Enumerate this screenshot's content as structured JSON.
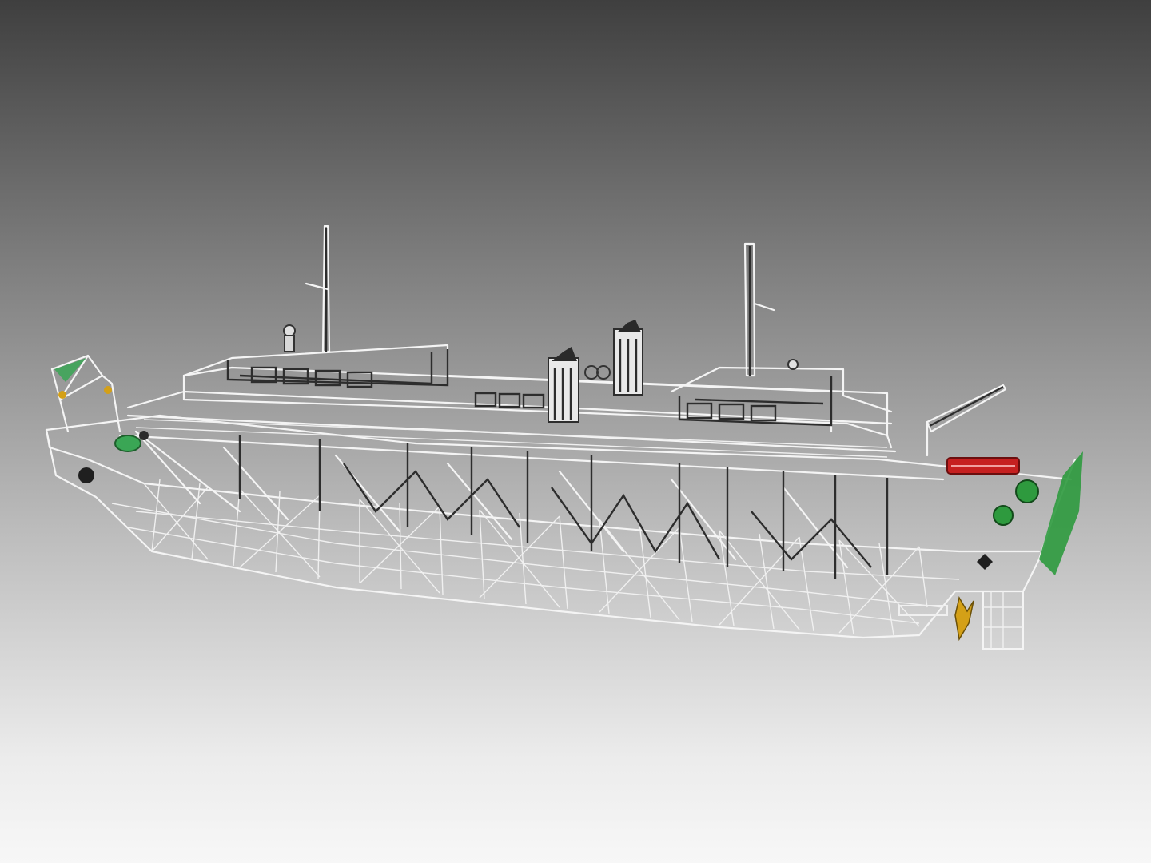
{
  "viewport": {
    "background_top": "#3f3f3f",
    "background_bottom": "#f7f7f7",
    "model": "ship-hull-wireframe"
  },
  "colors": {
    "wire": "#f4f4f4",
    "wire_shadow": "#2d2d2d",
    "bow_equipment": "#3aa655",
    "stern_equipment": "#2e9a3e",
    "liferaft": "#c62020",
    "propeller": "#d4a017"
  },
  "parts": [
    "hull",
    "superstructure",
    "fore-mast",
    "aft-mast",
    "funnel-port",
    "funnel-starboard",
    "crane-boom",
    "liferaft",
    "propeller",
    "rudder",
    "bow-winch",
    "stern-winch"
  ]
}
